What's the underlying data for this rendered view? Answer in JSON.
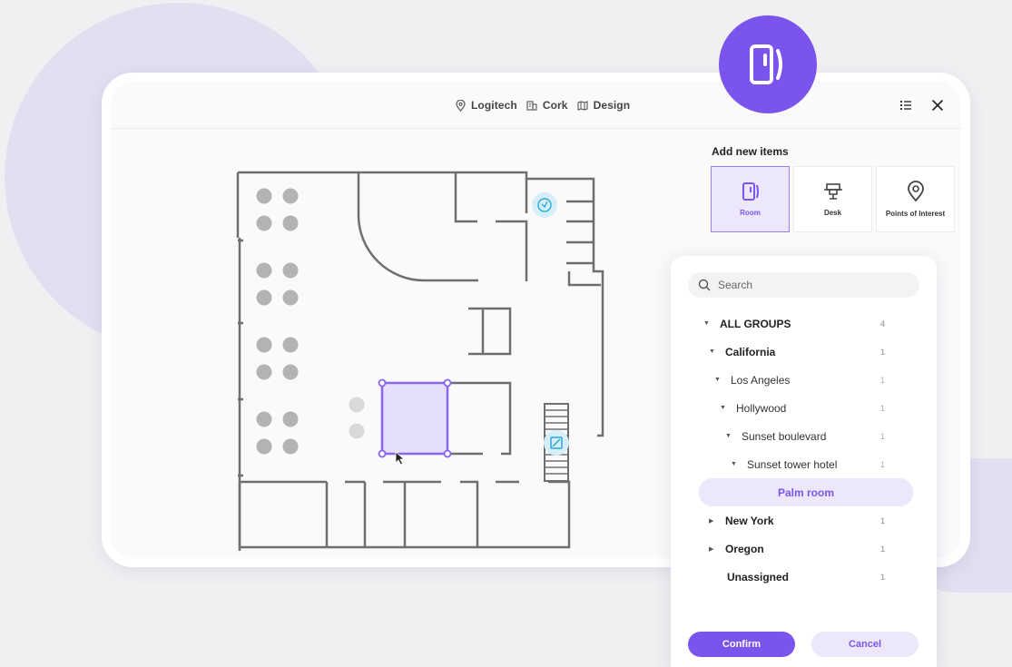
{
  "breadcrumb": {
    "location": "Logitech",
    "building": "Cork",
    "floor": "Design"
  },
  "toolbar": {
    "list_icon": "list-icon",
    "close_icon": "close-icon"
  },
  "add_items": {
    "heading": "Add new items",
    "tiles": [
      {
        "label": "Room",
        "icon": "room-icon",
        "active": true
      },
      {
        "label": "Desk",
        "icon": "desk-icon",
        "active": false
      },
      {
        "label": "Points of Interest",
        "icon": "location-pin-icon",
        "active": false
      }
    ]
  },
  "panel": {
    "search_placeholder": "Search",
    "tree": [
      {
        "label": "ALL GROUPS",
        "count": "4"
      },
      {
        "label": "California",
        "count": "1"
      },
      {
        "label": "Los Angeles",
        "count": "1"
      },
      {
        "label": "Hollywood",
        "count": "1"
      },
      {
        "label": "Sunset boulevard",
        "count": "1"
      },
      {
        "label": "Sunset tower hotel",
        "count": "1"
      },
      {
        "label": "Palm room"
      },
      {
        "label": "New York",
        "count": "1"
      },
      {
        "label": "Oregon",
        "count": "1"
      },
      {
        "label": "Unassigned",
        "count": "1"
      }
    ],
    "confirm_label": "Confirm",
    "cancel_label": "Cancel"
  },
  "colors": {
    "accent": "#7a54ec",
    "accent_light": "#ece7fb",
    "wall": "#6f6f6f",
    "desk": "#b3b3b3",
    "poi": "#29a8d6"
  }
}
